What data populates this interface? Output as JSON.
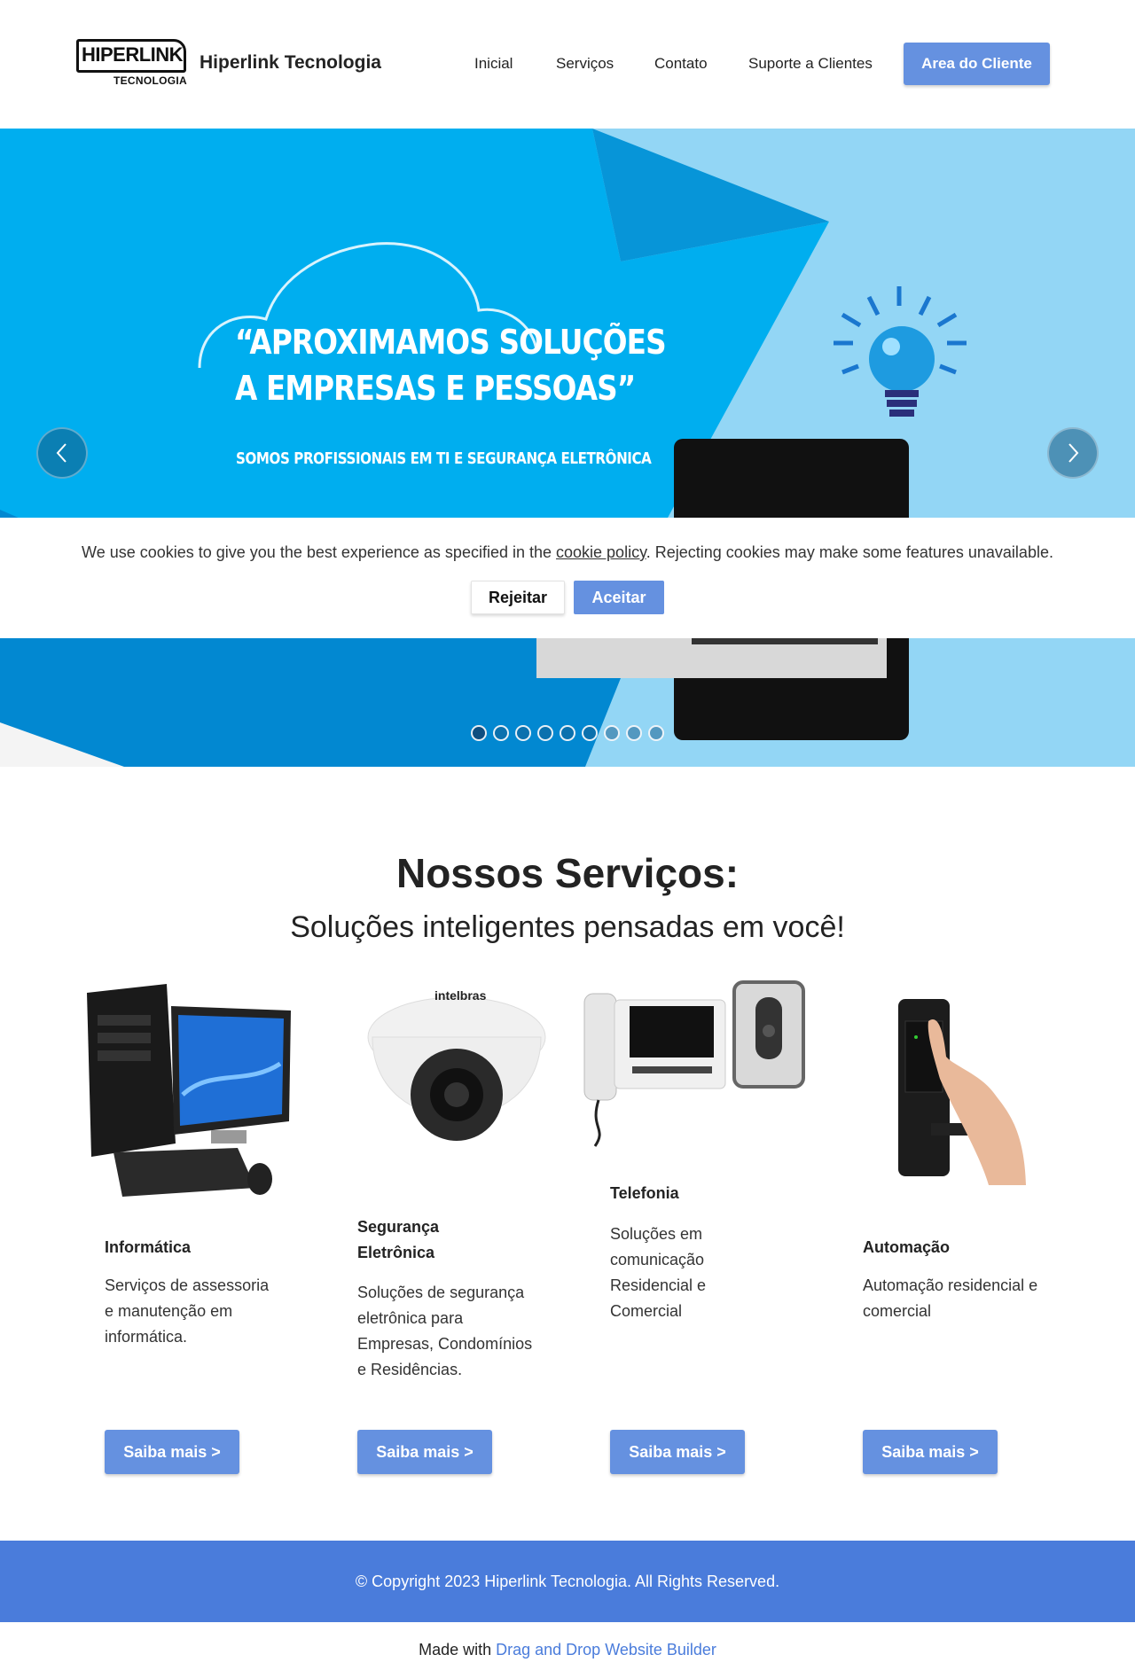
{
  "header": {
    "logo_main": "HIPERLINK",
    "logo_sub": "TECNOLOGIA",
    "brand": "Hiperlink Tecnologia",
    "nav": [
      "Inicial",
      "Serviços",
      "Contato",
      "Suporte a Clientes"
    ],
    "client_button": "Area do Cliente",
    "accent_color": "#6591e0"
  },
  "hero": {
    "title_line1": "“APROXIMAMOS SOLUÇÕES",
    "title_line2": "A EMPRESAS E PESSOAS”",
    "subtitle": "SOMOS PROFISSIONAIS EM TI E SEGURANÇA ELETRÔNICA",
    "prev_icon": "chevron-left-icon",
    "next_icon": "chevron-right-icon",
    "slide_count": 9,
    "active_slide": 1
  },
  "cookie": {
    "text_before": "We use cookies to give you the best experience as specified in the ",
    "link_text": "cookie policy",
    "text_after": ". Rejecting cookies may make some features unavailable.",
    "reject_label": "Rejeitar",
    "accept_label": "Aceitar"
  },
  "services": {
    "title": "Nossos Serviços:",
    "subtitle": "Soluções inteligentes pensadas em você!",
    "items": [
      {
        "title": "Informática",
        "desc": "Serviços de assessoria e manutenção em informática.",
        "button": "Saiba mais >"
      },
      {
        "title": "Segurança Eletrônica",
        "desc": "Soluções de segurança eletrônica para Empresas, Condomínios e Residências.",
        "button": "Saiba mais >"
      },
      {
        "title": "Telefonia",
        "desc": "Soluções em comunicação Residencial e Comercial",
        "button": "Saiba mais >"
      },
      {
        "title": "Automação",
        "desc": "Automação residencial e comercial",
        "button": "Saiba mais >"
      }
    ],
    "camera_brand": "intelbras"
  },
  "footer": {
    "copyright": "© Copyright 2023 Hiperlink Tecnologia. All Rights Reserved.",
    "made_with": "Made with ",
    "builder_link": "Drag and Drop Website Builder"
  }
}
